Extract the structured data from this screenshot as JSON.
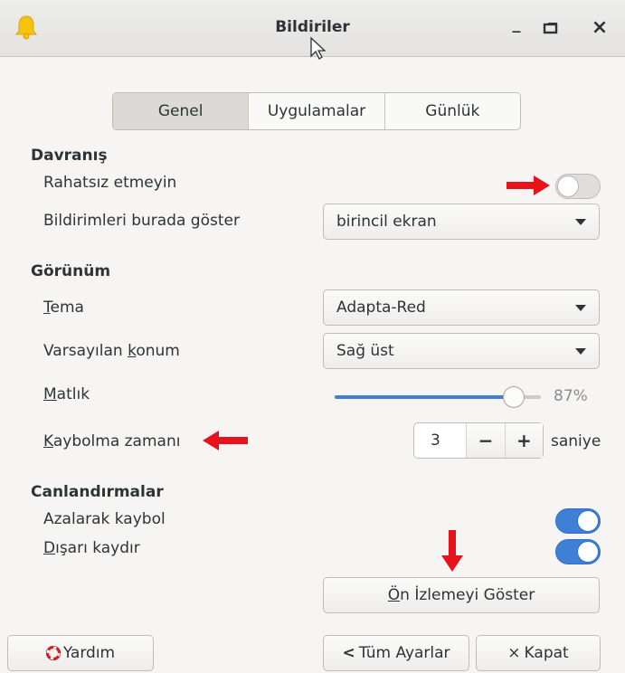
{
  "window": {
    "title": "Bildiriler",
    "minimize_glyph": "_",
    "maximize_glyph": "⧉",
    "close_glyph": "×"
  },
  "tabs": [
    {
      "label": "Genel",
      "active": true
    },
    {
      "label": "Uygulamalar",
      "active": false
    },
    {
      "label": "Günlük",
      "active": false
    }
  ],
  "behavior": {
    "heading": "Davranış",
    "dnd_label": "Rahatsız etmeyin",
    "dnd_on": false,
    "display_label": "Bildirimleri burada göster",
    "display_value": "birincil ekran"
  },
  "appearance": {
    "heading": "Görünüm",
    "theme_label_prefix": "T",
    "theme_label_rest": "ema",
    "theme_value": "Adapta-Red",
    "position_label_prefix": "Varsayılan ",
    "position_label_mnemonic": "k",
    "position_label_rest": "onum",
    "position_value": "Sağ üst",
    "opacity_label_mnemonic": "M",
    "opacity_label_rest": "atlık",
    "opacity_value": 87,
    "opacity_text": "87%",
    "timeout_label_mnemonic": "K",
    "timeout_label_rest": "aybolma zamanı",
    "timeout_value": "3",
    "timeout_minus": "−",
    "timeout_plus": "+",
    "timeout_unit": "saniye"
  },
  "animations": {
    "heading": "Canlandırmalar",
    "fade_label": "Azalarak kaybol",
    "fade_on": true,
    "slide_label_mnemonic": "D",
    "slide_label_rest": "ışarı kaydır",
    "slide_on": true
  },
  "preview_button": {
    "mnemonic": "Ö",
    "rest": "n İzlemeyi Göster"
  },
  "footer": {
    "help_label": "Yardım",
    "all_settings_label": "Tüm Ayarlar",
    "close_label": "Kapat"
  },
  "icons": {
    "app": "bell-icon",
    "help": "lifebuoy-icon",
    "back": "chevron-left-icon",
    "close": "close-icon"
  },
  "colors": {
    "accent": "#3f7fd6",
    "annotation_arrow": "#e8121a",
    "bell": "#f5c211"
  }
}
